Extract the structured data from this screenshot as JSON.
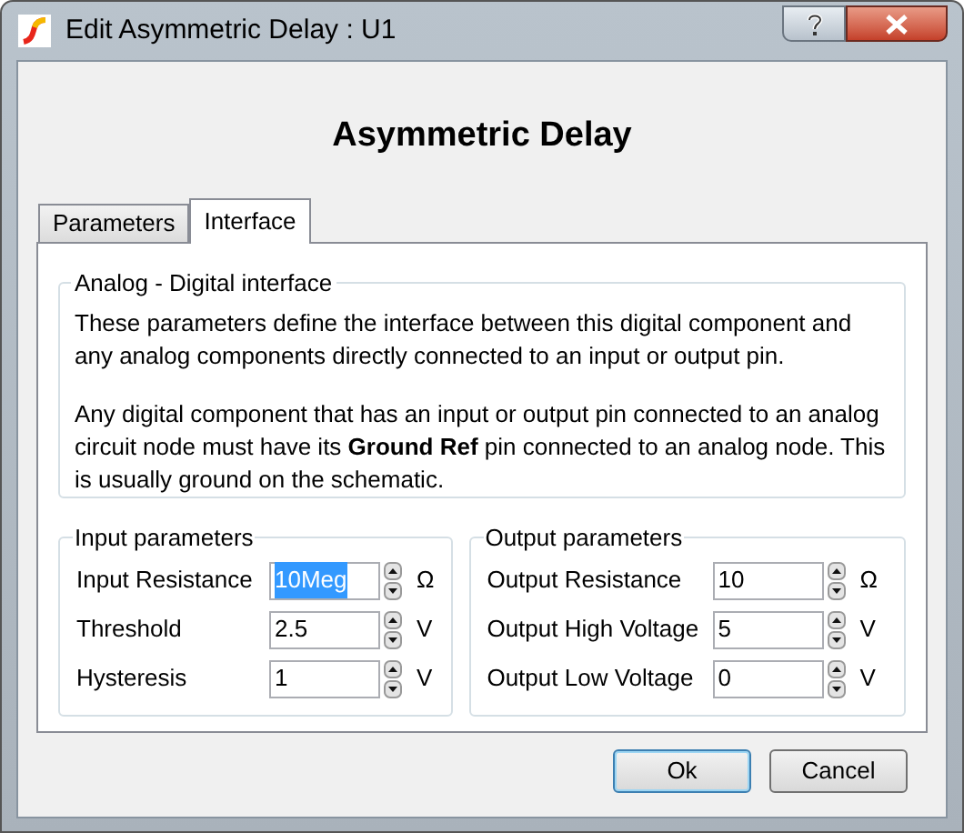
{
  "window": {
    "title": "Edit Asymmetric Delay : U1"
  },
  "heading": "Asymmetric Delay",
  "tabs": [
    {
      "label": "Parameters",
      "selected": false
    },
    {
      "label": "Interface",
      "selected": true
    }
  ],
  "interface_group": {
    "title": "Analog - Digital interface",
    "paragraphs": [
      "These parameters define the interface between this digital component and any analog components directly connected to an input or output pin.",
      "Any digital component that has an input or output pin connected to an analog circuit node must have its **Ground Ref** pin connected to an analog node. This is usually ground on the schematic."
    ]
  },
  "parameter_groups": [
    {
      "title": "Input parameters",
      "rows": [
        {
          "label": "Input Resistance",
          "value": "10Meg",
          "unit": "Ω",
          "selected": true
        },
        {
          "label": "Threshold",
          "value": "2.5",
          "unit": "V",
          "selected": false
        },
        {
          "label": "Hysteresis",
          "value": "1",
          "unit": "V",
          "selected": false
        }
      ]
    },
    {
      "title": "Output parameters",
      "rows": [
        {
          "label": "Output Resistance",
          "value": "10",
          "unit": "Ω",
          "selected": false
        },
        {
          "label": "Output High Voltage",
          "value": "5",
          "unit": "V",
          "selected": false
        },
        {
          "label": "Output Low Voltage",
          "value": "0",
          "unit": "V",
          "selected": false
        }
      ]
    }
  ],
  "buttons": [
    {
      "label": "Ok",
      "default": true
    },
    {
      "label": "Cancel",
      "default": false
    }
  ]
}
